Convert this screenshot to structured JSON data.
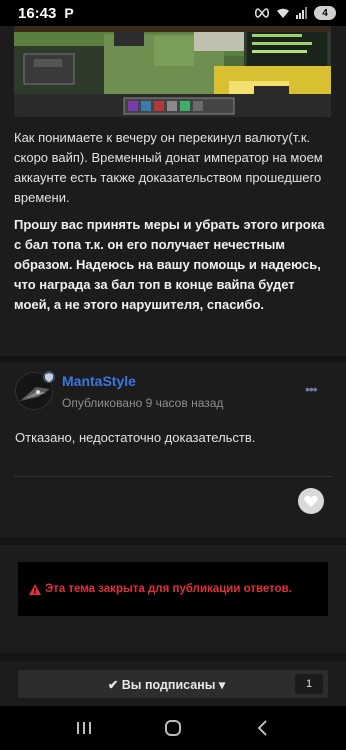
{
  "status_bar": {
    "time": "16:43",
    "app_glyph": "P",
    "battery_level": "4"
  },
  "post": {
    "paragraph_1": "Как понимаете к вечеру он перекинул валюту(т.к. скоро вайп). Временный донат император на моем аккаунте есть также доказательством прошедшего времени.",
    "paragraph_2": "Прошу вас принять меры и убрать этого игрока с бал топа т.к. он его получает нечестным образом. Надеюсь на вашу помощь и надеюсь, что награда за бал топ в конце вайпа будет моей, а не этого нарушителя, спасибо."
  },
  "reply": {
    "author": "MantaStyle",
    "published": "Опубликовано 9 часов назад",
    "text": "Отказано, недостаточно доказательств.",
    "more": "•••"
  },
  "topic": {
    "locked_notice": "Эта тема закрыта для публикации ответов.",
    "follow_label": "✔ Вы подписаны ▾",
    "follower_count": "1"
  },
  "colors": {
    "author_link": "#3a77e0",
    "locked_red": "#e0303a",
    "page_bg": "#1c1c1c"
  },
  "icons": [
    "infinity-icon",
    "wifi-icon",
    "signal-icon",
    "battery-icon",
    "shield-badge-icon",
    "more-dots-icon",
    "heart-icon",
    "warning-icon",
    "check-icon",
    "caret-down-icon",
    "nav-recents-icon",
    "nav-home-icon",
    "nav-back-icon"
  ]
}
